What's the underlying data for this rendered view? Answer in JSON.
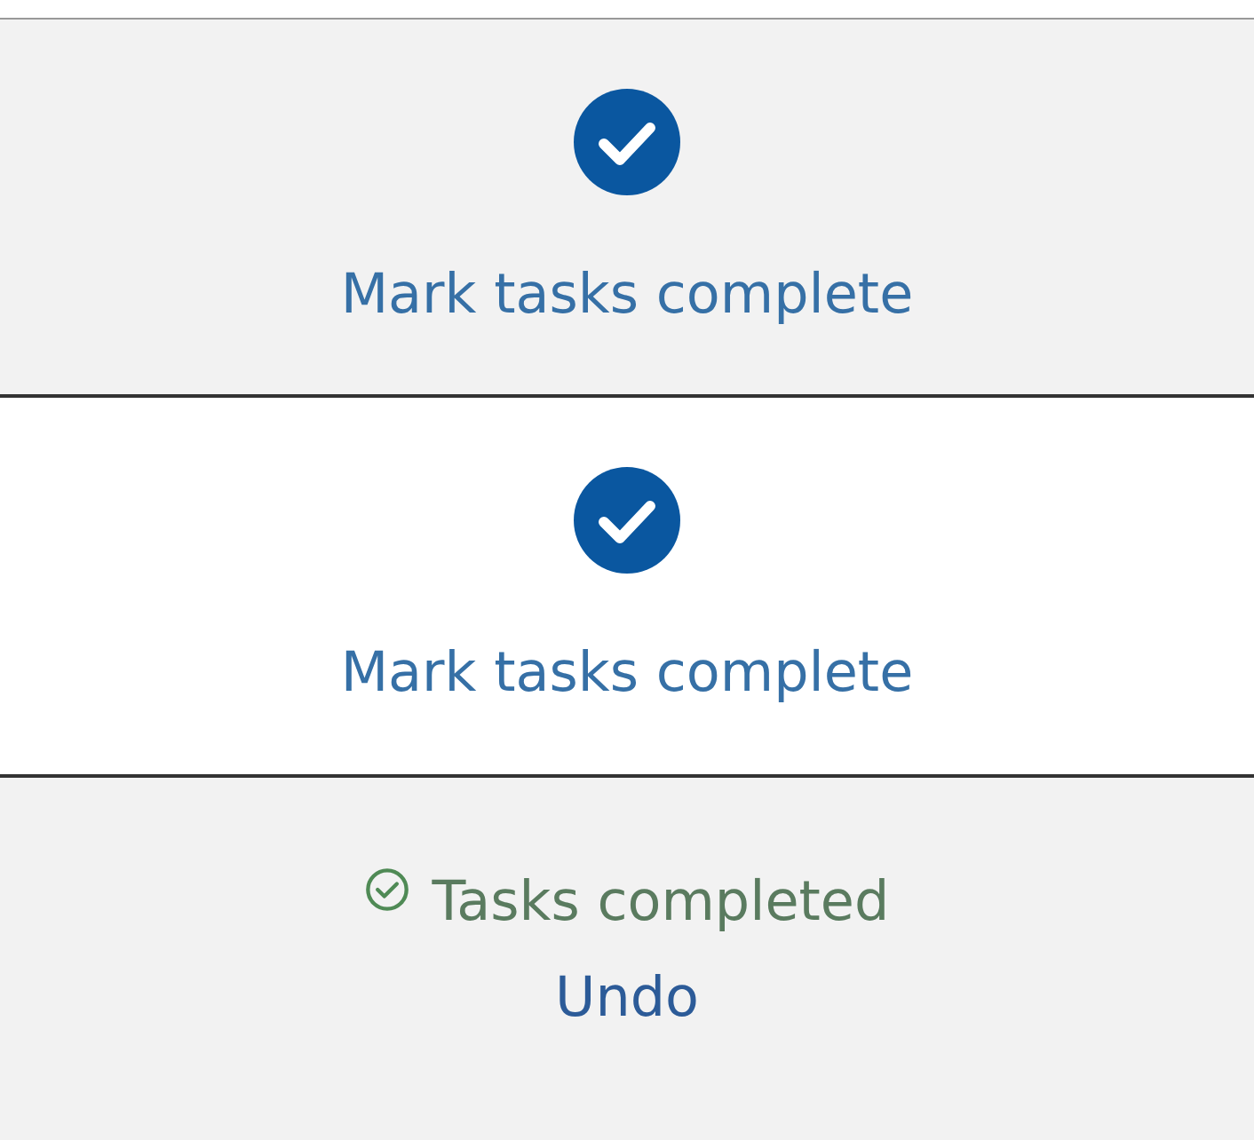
{
  "panels": [
    {
      "kind": "action",
      "hovered": true,
      "label": "Mark tasks complete"
    },
    {
      "kind": "action",
      "hovered": false,
      "label": "Mark tasks complete"
    },
    {
      "kind": "done",
      "hovered": true,
      "label": "Tasks completed",
      "link": "Undo"
    }
  ]
}
